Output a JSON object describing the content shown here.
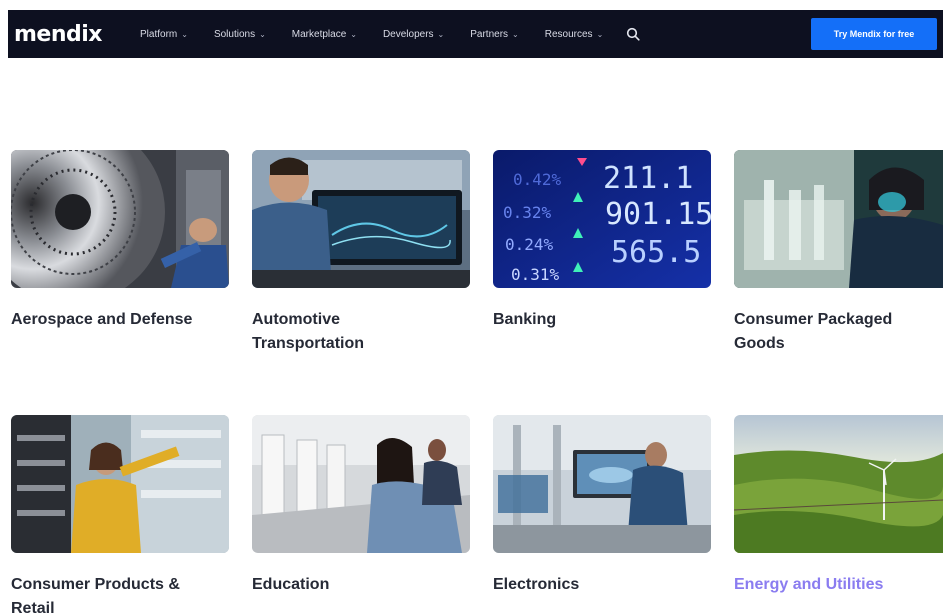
{
  "brand": {
    "logo_text": "mendix"
  },
  "nav": {
    "items": [
      {
        "label": "Platform"
      },
      {
        "label": "Solutions"
      },
      {
        "label": "Marketplace"
      },
      {
        "label": "Developers"
      },
      {
        "label": "Partners"
      },
      {
        "label": "Resources"
      }
    ],
    "search_icon": "search-icon",
    "cta_label": "Try Mendix for free"
  },
  "industries": [
    {
      "title": "Aerospace and Defense"
    },
    {
      "title": "Automotive Transportation"
    },
    {
      "title": "Banking"
    },
    {
      "title": "Consumer Packaged Goods"
    },
    {
      "title": "Consumer Products & Retail"
    },
    {
      "title": "Education"
    },
    {
      "title": "Electronics"
    },
    {
      "title": "Energy and Utilities"
    }
  ],
  "banking_ticker": [
    "211.1",
    "901.15",
    "565.5",
    "0.42%",
    "0.32%",
    "0.24%",
    "0.31%"
  ],
  "colors": {
    "nav_bg": "#0d1020",
    "cta_bg": "#146ff8",
    "accent_link": "#8a7cf0"
  }
}
